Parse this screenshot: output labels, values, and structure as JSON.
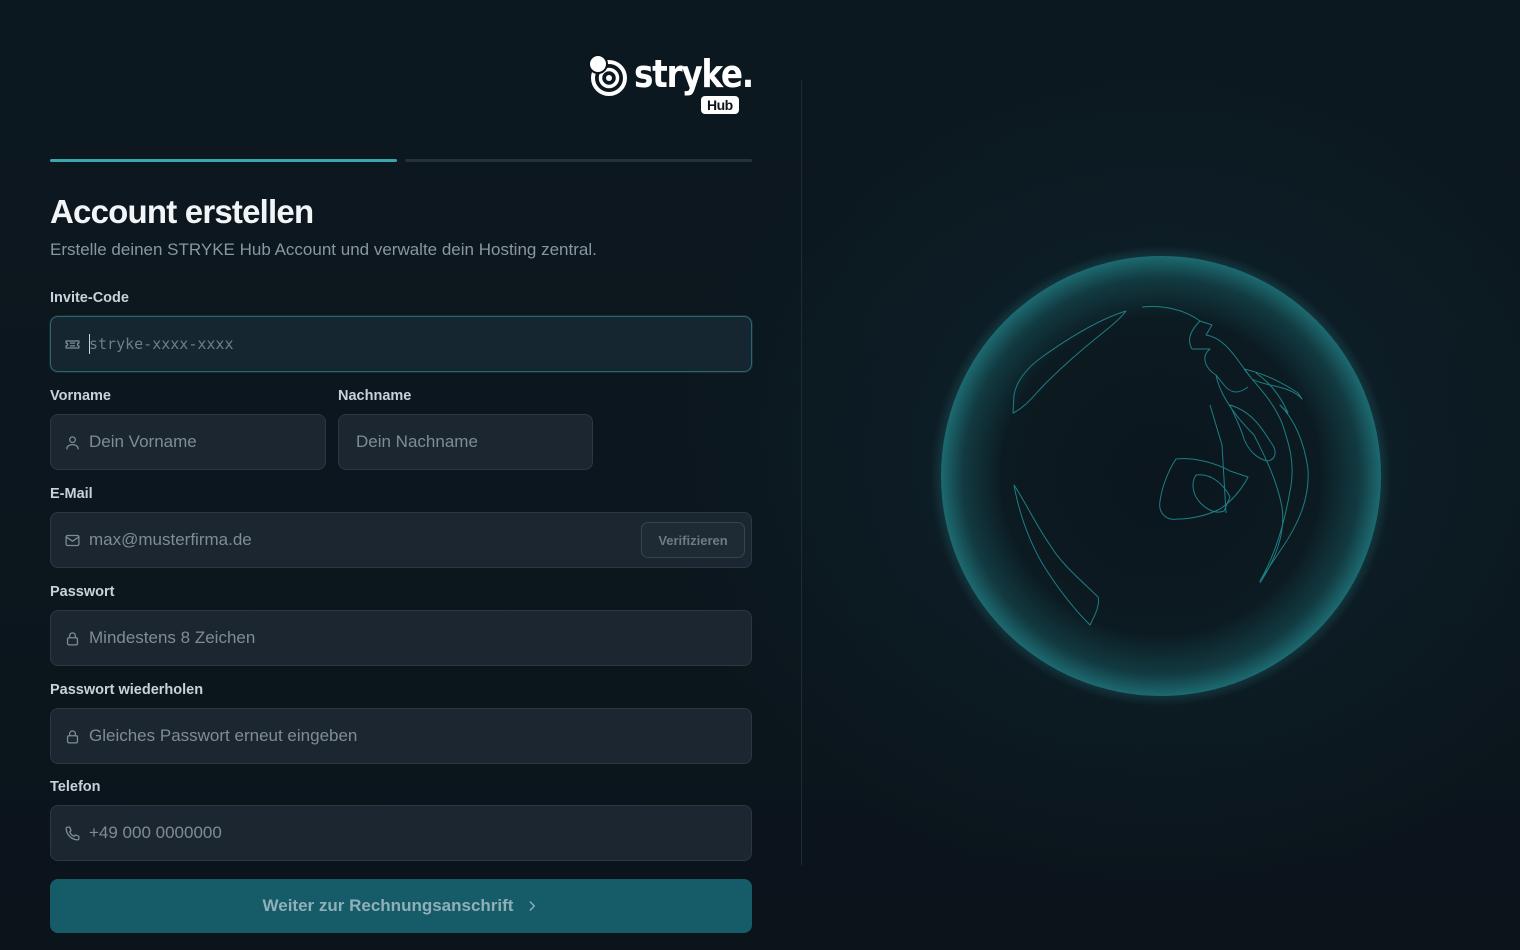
{
  "brand": {
    "wordmark": "stryke.",
    "sub": "Hub"
  },
  "progress": {
    "steps": 2,
    "current": 1
  },
  "heading": {
    "title": "Account erstellen",
    "subtitle": "Erstelle deinen STRYKE Hub Account und verwalte dein Hosting zentral."
  },
  "form": {
    "invite": {
      "label": "Invite-Code",
      "placeholder": "stryke-xxxx-xxxx",
      "icon": "ticket-icon"
    },
    "firstname": {
      "label": "Vorname",
      "placeholder": "Dein Vorname",
      "icon": "user-icon"
    },
    "lastname": {
      "label": "Nachname",
      "placeholder": "Dein Nachname"
    },
    "email": {
      "label": "E-Mail",
      "placeholder": "max@musterfirma.de",
      "icon": "mail-icon",
      "verify_label": "Verifizieren"
    },
    "password": {
      "label": "Passwort",
      "placeholder": "Mindestens 8 Zeichen",
      "icon": "lock-icon"
    },
    "password_repeat": {
      "label": "Passwort wiederholen",
      "placeholder": "Gleiches Passwort erneut eingeben",
      "icon": "lock-icon"
    },
    "phone": {
      "label": "Telefon",
      "placeholder": "+49 000 0000000",
      "icon": "phone-icon"
    },
    "submit_label": "Weiter zur Rechnungsanschrift"
  },
  "colors": {
    "background": "#0b141b",
    "accent": "#3aa6b0",
    "field_bg": "#1b2630",
    "button_bg": "#155b68",
    "globe": "#1f6d73"
  }
}
